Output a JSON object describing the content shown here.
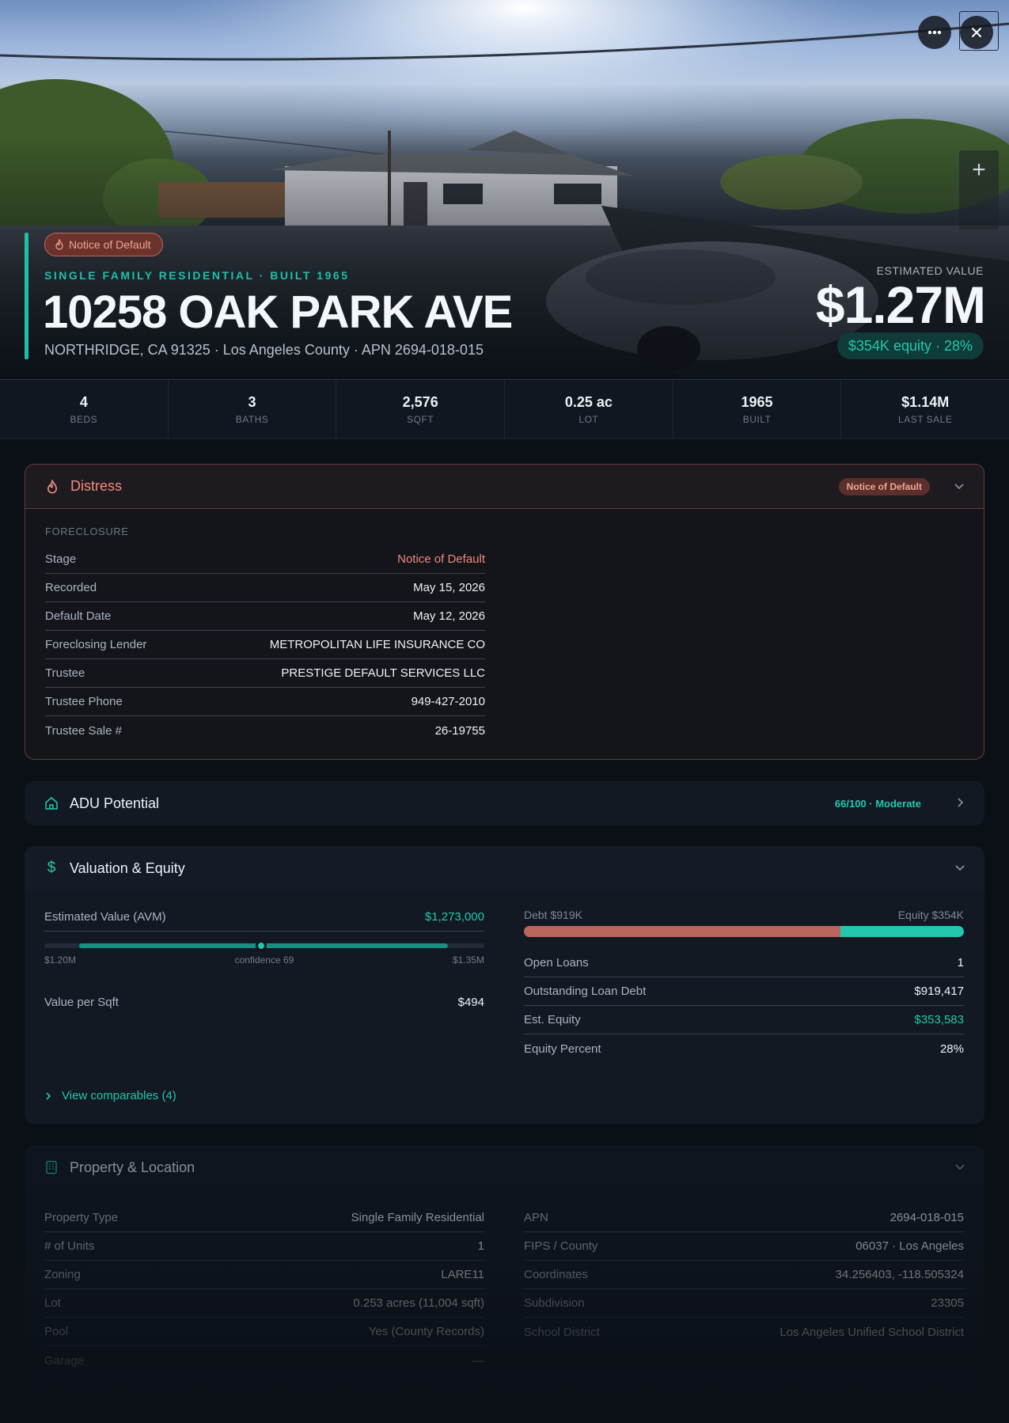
{
  "hero": {
    "distress_badge": "Notice of Default",
    "kicker": "SINGLE FAMILY RESIDENTIAL · BUILT 1965",
    "address": "10258 OAK PARK AVE",
    "subline": "NORTHRIDGE, CA 91325 · Los Angeles County · APN 2694-018-015",
    "estimated_label": "ESTIMATED VALUE",
    "estimated_value": "$1.27M",
    "equity_pill": "$354K equity · 28%",
    "more_icon": "more-horizontal-icon",
    "close_icon": "close-icon",
    "zoom_in_icon": "plus-icon"
  },
  "stats": [
    {
      "value": "4",
      "label": "BEDS"
    },
    {
      "value": "3",
      "label": "BATHS"
    },
    {
      "value": "2,576",
      "label": "SQFT"
    },
    {
      "value": "0.25 ac",
      "label": "LOT"
    },
    {
      "value": "1965",
      "label": "BUILT"
    },
    {
      "value": "$1.14M",
      "label": "LAST SALE"
    }
  ],
  "distress": {
    "title": "Distress",
    "badge": "Notice of Default",
    "section": "FORECLOSURE",
    "rows": [
      {
        "k": "Stage",
        "v": "Notice of Default"
      },
      {
        "k": "Recorded",
        "v": "May 15, 2026"
      },
      {
        "k": "Default Date",
        "v": "May 12, 2026"
      },
      {
        "k": "Foreclosing Lender",
        "v": "METROPOLITAN LIFE INSURANCE CO"
      },
      {
        "k": "Trustee",
        "v": "PRESTIGE DEFAULT SERVICES LLC"
      },
      {
        "k": "Trustee Phone",
        "v": "949-427-2010"
      },
      {
        "k": "Trustee Sale #",
        "v": "26-19755"
      }
    ]
  },
  "adu": {
    "title": "ADU Potential",
    "score": "66/100 · Moderate"
  },
  "valuation": {
    "title": "Valuation & Equity",
    "avm_label": "Estimated Value (AVM)",
    "avm_value": "$1,273,000",
    "range_low": "$1.20M",
    "confidence": "confidence 69",
    "range_high": "$1.35M",
    "ppsf_label": "Value per Sqft",
    "ppsf_value": "$494",
    "debt_label": "Debt $919K",
    "equity_label": "Equity $354K",
    "debt_fraction": 0.72,
    "rows": [
      {
        "k": "Open Loans",
        "v": "1"
      },
      {
        "k": "Outstanding Loan Debt",
        "v": "$919,417"
      },
      {
        "k": "Est. Equity",
        "v": "$353,583"
      },
      {
        "k": "Equity Percent",
        "v": "28%"
      }
    ],
    "comps_link": "View comparables (4)"
  },
  "property": {
    "title": "Property & Location",
    "left": [
      {
        "k": "Property Type",
        "v": "Single Family Residential"
      },
      {
        "k": "# of Units",
        "v": "1"
      },
      {
        "k": "Zoning",
        "v": "LARE11"
      },
      {
        "k": "Lot",
        "v": "0.253 acres (11,004 sqft)"
      },
      {
        "k": "Pool",
        "v": "Yes (County Records)"
      },
      {
        "k": "Garage",
        "v": "—"
      }
    ],
    "right": [
      {
        "k": "APN",
        "v": "2694-018-015"
      },
      {
        "k": "FIPS / County",
        "v": "06037 · Los Angeles"
      },
      {
        "k": "Coordinates",
        "v": "34.256403, -118.505324"
      },
      {
        "k": "Subdivision",
        "v": "23305"
      },
      {
        "k": "School District",
        "v": "Los Angeles Unified School District"
      }
    ]
  },
  "colors": {
    "accent": "#23c7ad",
    "distress": "#ef8a78",
    "background": "#0b0f16"
  }
}
